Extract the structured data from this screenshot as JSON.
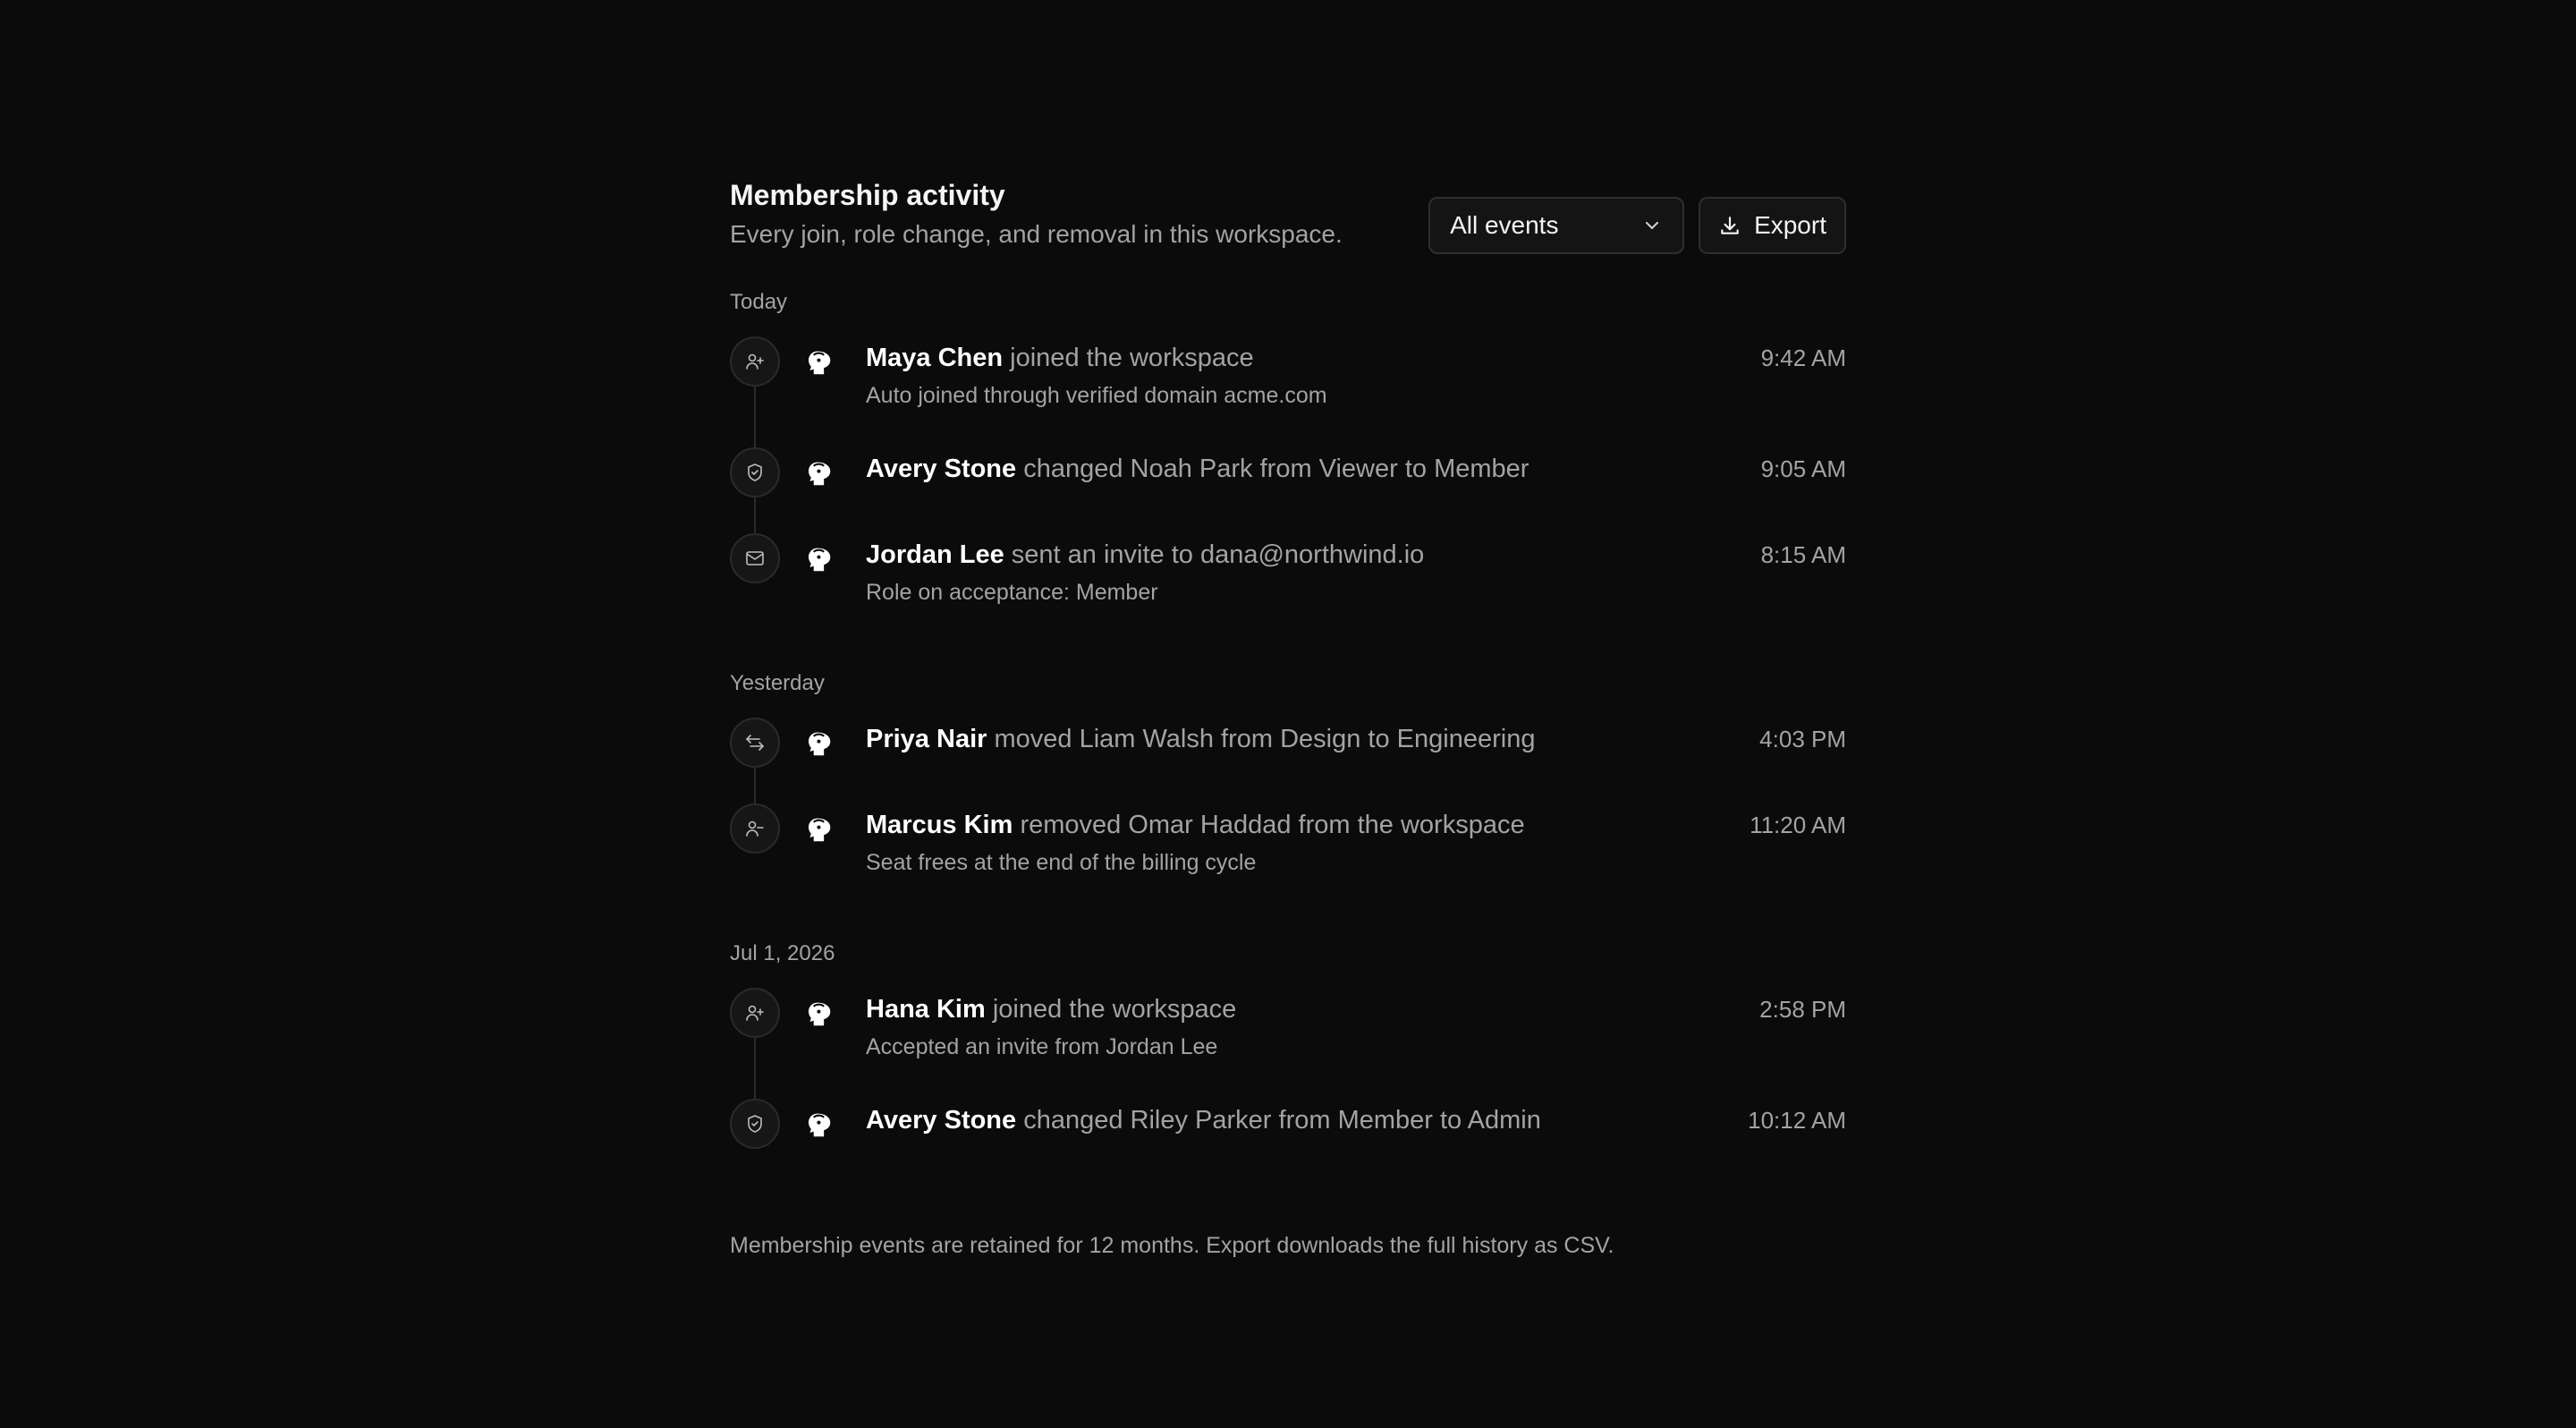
{
  "header": {
    "title": "Membership activity",
    "subtitle": "Every join, role change, and removal in this workspace.",
    "filter": {
      "value": "All events",
      "icon": "chevron-down-icon"
    },
    "export_label": "Export",
    "export_icon": "download-icon"
  },
  "groups": [
    {
      "label": "Today",
      "events": [
        {
          "icon": "user-plus-icon",
          "actor": "Maya Chen",
          "action": "joined the workspace",
          "detail": "Auto joined through verified domain acme.com",
          "time": "9:42 AM"
        },
        {
          "icon": "shield-icon",
          "actor": "Avery Stone",
          "action": "changed Noah Park from Viewer to Member",
          "detail": "",
          "time": "9:05 AM"
        },
        {
          "icon": "mail-icon",
          "actor": "Jordan Lee",
          "action": "sent an invite to dana@northwind.io",
          "detail": "Role on acceptance: Member",
          "time": "8:15 AM"
        }
      ]
    },
    {
      "label": "Yesterday",
      "events": [
        {
          "icon": "arrows-swap-icon",
          "actor": "Priya Nair",
          "action": "moved Liam Walsh from Design to Engineering",
          "detail": "",
          "time": "4:03 PM"
        },
        {
          "icon": "user-minus-icon",
          "actor": "Marcus Kim",
          "action": "removed Omar Haddad from the workspace",
          "detail": "Seat frees at the end of the billing cycle",
          "time": "11:20 AM"
        }
      ]
    },
    {
      "label": "Jul 1, 2026",
      "events": [
        {
          "icon": "user-plus-icon",
          "actor": "Hana Kim",
          "action": "joined the workspace",
          "detail": "Accepted an invite from Jordan Lee",
          "time": "2:58 PM"
        },
        {
          "icon": "shield-icon",
          "actor": "Avery Stone",
          "action": "changed Riley Parker from Member to Admin",
          "detail": "",
          "time": "10:12 AM"
        }
      ]
    }
  ],
  "footer": "Membership events are retained for 12 months. Export downloads the full history as CSV."
}
